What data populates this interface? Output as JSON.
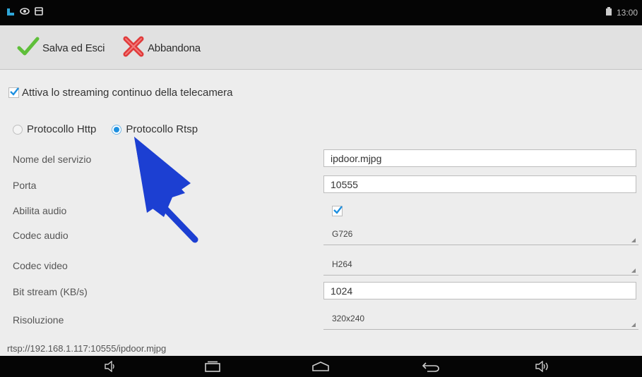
{
  "status": {
    "time": "13:00",
    "icons": [
      "app-notification-icon",
      "eye-icon",
      "box-icon",
      "battery-icon"
    ]
  },
  "toolbar": {
    "save_label": "Salva ed Esci",
    "cancel_label": "Abbandona"
  },
  "streaming": {
    "checkbox_label": "Attiva lo streaming continuo della telecamera",
    "checked": true
  },
  "protocols": [
    {
      "label": "Protocollo Http",
      "selected": false
    },
    {
      "label": "Protocollo Rtsp",
      "selected": true
    }
  ],
  "form": {
    "service_name": {
      "label": "Nome del servizio",
      "value": "ipdoor.mjpg"
    },
    "port": {
      "label": "Porta",
      "value": "10555"
    },
    "audio_enabled": {
      "label": "Abilita audio",
      "checked": true
    },
    "audio_codec": {
      "label": "Codec audio",
      "value": "G726"
    },
    "video_codec": {
      "label": "Codec video",
      "value": "H264"
    },
    "bitstream": {
      "label": "Bit stream (KB/s)",
      "value": "1024"
    },
    "resolution": {
      "label": "Risoluzione",
      "value": "320x240"
    }
  },
  "footer_url": "rtsp://192.168.1.117:10555/ipdoor.mjpg",
  "navbar": {
    "icons": [
      "volume-down-icon",
      "recent-apps-icon",
      "home-icon",
      "back-icon",
      "volume-up-icon"
    ]
  },
  "colors": {
    "accent": "#1e90e0",
    "arrow": "#1c3fd2",
    "save_check": "#5fbf3a",
    "cancel_x": "#e03a3a"
  }
}
